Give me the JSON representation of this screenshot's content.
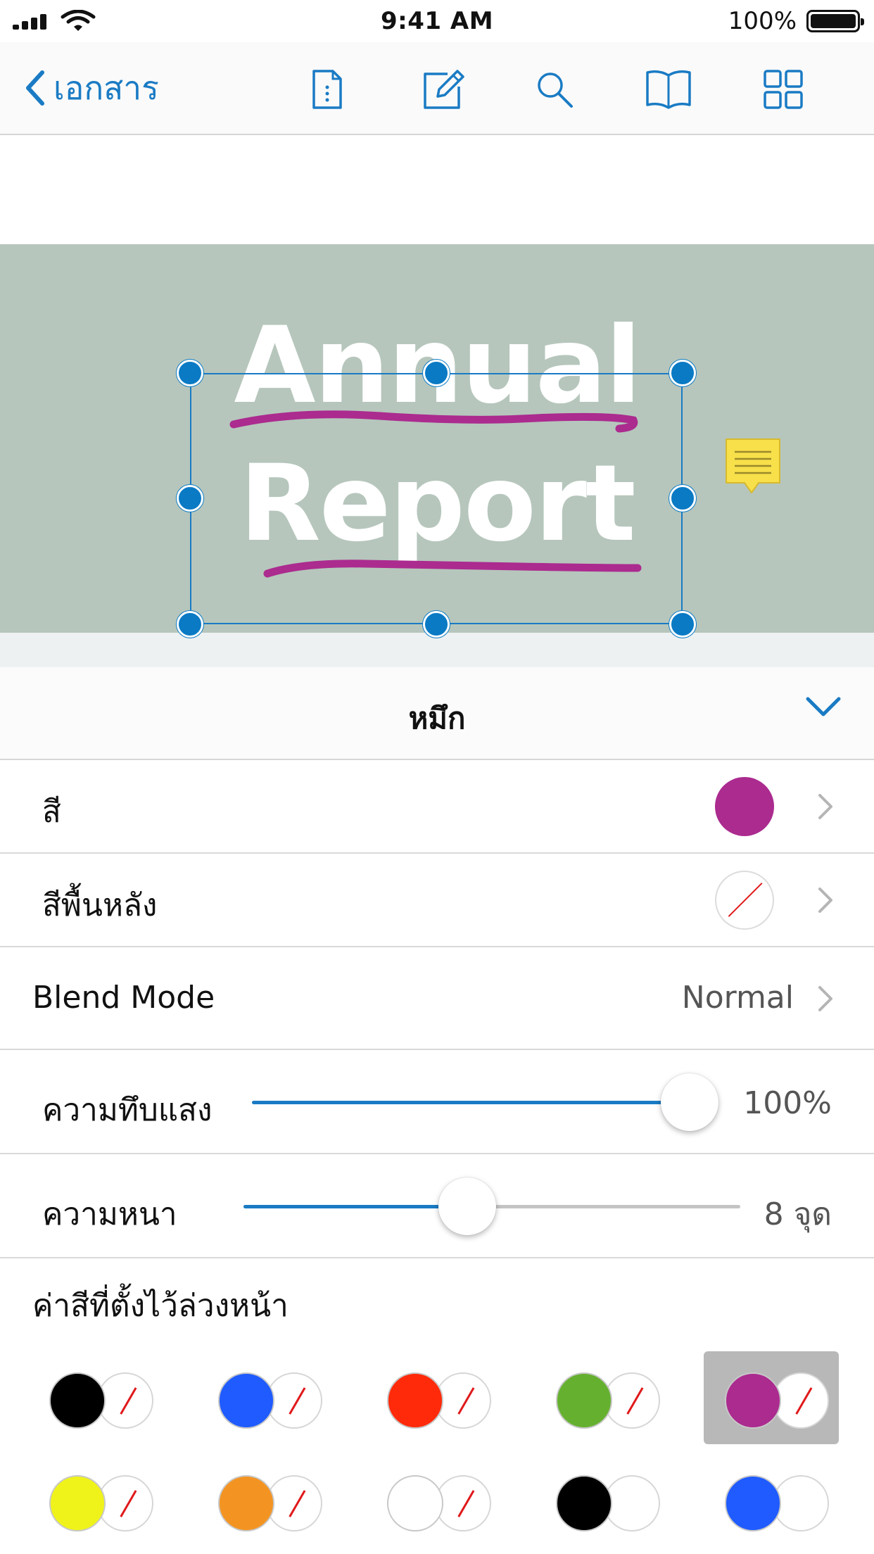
{
  "status": {
    "time": "9:41 AM",
    "battery": "100%"
  },
  "nav": {
    "back_label": "เอกสาร"
  },
  "document": {
    "title_line1": "Annual",
    "title_line2": "Report"
  },
  "panel": {
    "title": "หมึก",
    "color_label": "สี",
    "color_value": "#ab2b8f",
    "background_label": "สีพื้นหลัง",
    "blend_label": "Blend Mode",
    "blend_value": "Normal",
    "opacity_label": "ความทึบแสง",
    "opacity_value": "100%",
    "opacity_fraction": 1.0,
    "thickness_label": "ความหนา",
    "thickness_value": "8 จุด",
    "thickness_fraction": 0.45,
    "presets_label": "ค่าสีที่ตั้งไว้ล่วงหน้า"
  },
  "colors": {
    "accent": "#0a7ac4",
    "ink": "#ab2b8f",
    "banner": "#b6c6bc",
    "note": "#f7e04a"
  },
  "presets": [
    {
      "fill": "#000000",
      "stroke": "none"
    },
    {
      "fill": "#1f5bff",
      "stroke": "none"
    },
    {
      "fill": "#ff2a0a",
      "stroke": "none"
    },
    {
      "fill": "#66b030",
      "stroke": "none"
    },
    {
      "fill": "#ab2b8f",
      "stroke": "none",
      "selected": true
    },
    {
      "fill": "#f0f31a",
      "stroke": "none"
    },
    {
      "fill": "#f39422",
      "stroke": "none"
    },
    {
      "fill": "#ffffff",
      "stroke": "none"
    },
    {
      "fill": "#000000",
      "stroke": "#ffffff"
    },
    {
      "fill": "#1f5bff",
      "stroke": "#ffffff"
    }
  ]
}
